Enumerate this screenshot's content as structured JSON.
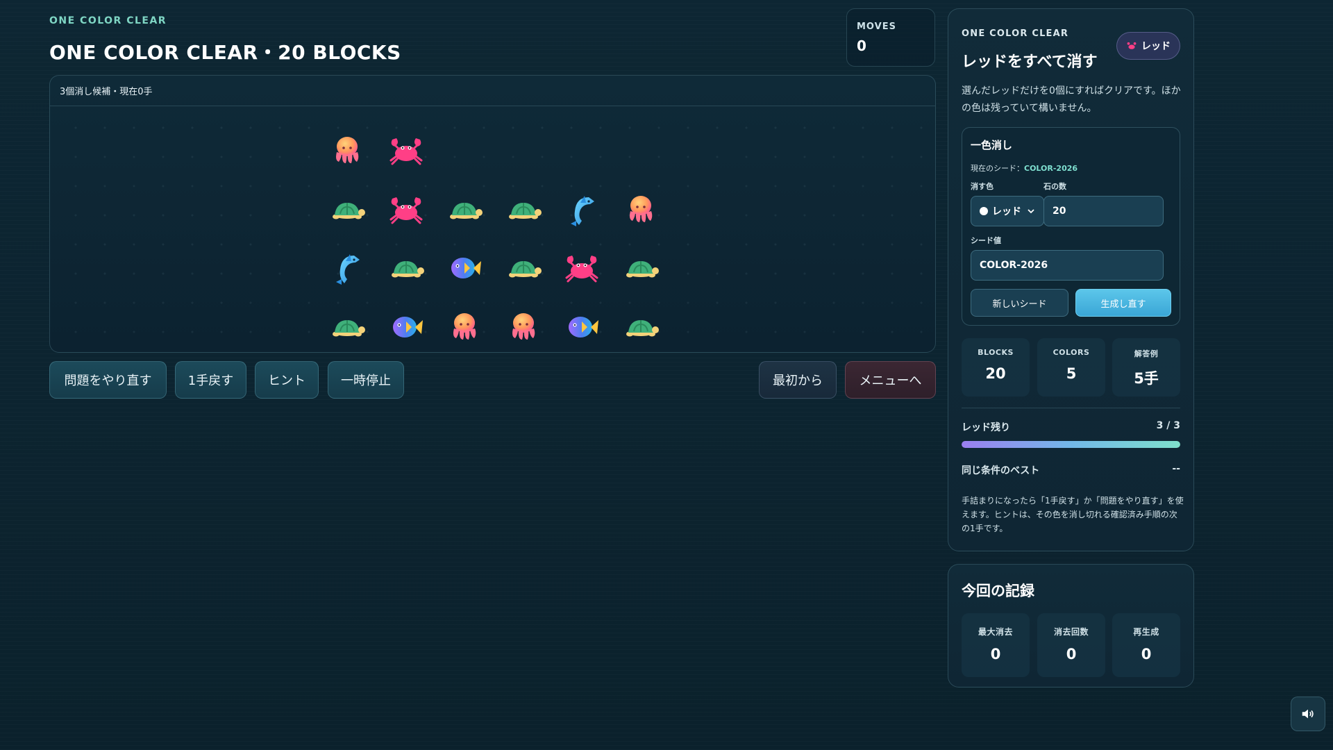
{
  "header": {
    "eyebrow": "ONE COLOR CLEAR",
    "title": "ONE COLOR CLEAR・20 BLOCKS"
  },
  "moves": {
    "label": "MOVES",
    "value": "0"
  },
  "board": {
    "status": "3個消し候補・現在0手",
    "grid": [
      [
        "octopus",
        "crab",
        null,
        null,
        null,
        null
      ],
      [
        "turtle",
        "crab",
        "turtle",
        "turtle",
        "dolphin",
        "octopus"
      ],
      [
        "dolphin",
        "turtle",
        "fish",
        "turtle",
        "crab",
        "turtle"
      ],
      [
        "turtle",
        "fish",
        "octopus",
        "octopus",
        "fish",
        "turtle"
      ]
    ]
  },
  "actions": {
    "retry": "問題をやり直す",
    "undo": "1手戻す",
    "hint": "ヒント",
    "pause": "一時停止",
    "restart": "最初から",
    "menu": "メニューへ"
  },
  "panel": {
    "eyebrow": "ONE COLOR CLEAR",
    "heading": "レッドをすべて消す",
    "badge": "レッド",
    "description": "選んだレッドだけを0個にすればクリアです。ほかの色は残っていて構いません。",
    "config": {
      "title": "一色消し",
      "current_seed_label": "現在のシード：",
      "current_seed": "COLOR-2026",
      "color_label": "消す色",
      "color_value": "レッド",
      "count_label": "石の数",
      "count_value": "20",
      "seed_label": "シード値",
      "seed_value": "COLOR-2026",
      "new_seed": "新しいシード",
      "regenerate": "生成し直す"
    },
    "stats": [
      {
        "label": "BLOCKS",
        "value": "20"
      },
      {
        "label": "COLORS",
        "value": "5"
      },
      {
        "label": "解答例",
        "value": "5手"
      }
    ],
    "remaining": {
      "label": "レッド残り",
      "value": "3 / 3",
      "fraction": 1.0
    },
    "best": {
      "label": "同じ条件のベスト",
      "value": "--"
    },
    "note": "手詰まりになったら「1手戻す」か「問題をやり直す」を使えます。ヒントは、その色を消し切れる確認済み手順の次の1手です。"
  },
  "record": {
    "title": "今回の記録",
    "stats": [
      {
        "label": "最大消去",
        "value": "0"
      },
      {
        "label": "消去回数",
        "value": "0"
      },
      {
        "label": "再生成",
        "value": "0"
      }
    ]
  },
  "colors": {
    "red": "#ff3f86",
    "accent": "#7fd6c4"
  }
}
